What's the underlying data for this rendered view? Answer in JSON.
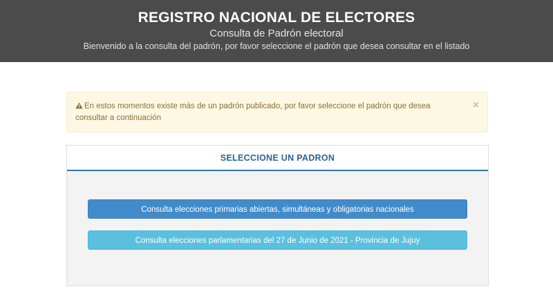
{
  "header": {
    "title": "REGISTRO NACIONAL DE ELECTORES",
    "subtitle": "Consulta de Padrón electoral",
    "welcome": "Bienvenido a la consulta del padrón, por favor seleccione el padrón que desea consultar en el listado"
  },
  "alert": {
    "icon": "warning-icon",
    "message": "En estos momentos existe más de un padrón publicado, por favor seleccione el padrón que desea consultar a continuación",
    "close_label": "×"
  },
  "panel": {
    "heading": "SELECCIONE UN PADRON",
    "options": [
      {
        "label": "Consulta elecciones primarias abiertas, simultáneas y obligatorias nacionales"
      },
      {
        "label": "Consulta elecciones parlamentarias del 27 de Junio de 2021 - Provincia de Jujuy"
      }
    ]
  },
  "colors": {
    "header_bg": "#4b4b4b",
    "alert_bg": "#fcf8e3",
    "alert_text": "#8a6d3b",
    "primary": "#428bca",
    "info": "#5bc0de",
    "panel_heading": "#2a6496"
  }
}
